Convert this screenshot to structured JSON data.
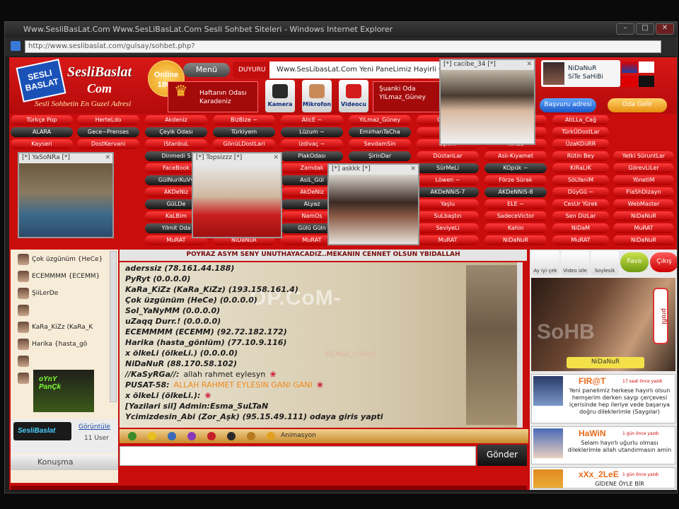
{
  "browser": {
    "title": "Www.SesliBasLat.Com Www.SesLiBasLat.Com Sesli Sohbet Siteleri - Windows Internet Explorer",
    "address": "http://www.seslibaslat.com/gulsay/sohbet.php?"
  },
  "header": {
    "logo_badge": "SESLI BASLAT",
    "logo_name": "SesliBaslat",
    "logo_com": "Com",
    "slogan": "Sesli Sohbetin En Guzel Adresi",
    "online_label": "Online",
    "online_count": "1803",
    "menu_label": "Menü",
    "ticker_tag": "DUYURU",
    "ticker_text": "Www.SesLibasLat.Com Yeni PaneLimiz Hayirli Olsun",
    "room_week_label": "Haftanın Odası",
    "room_week_name": "Karadeniz",
    "btn_camera": "Kamera",
    "btn_mic": "Mikrofon",
    "btn_video": "Videocu",
    "now_room_label": "Şuanki Oda",
    "now_room_name": "YILmaz_Güney",
    "owner_name": "NiDaNuR",
    "owner_title": "SiTe SaHiBi",
    "reg_label": "Başvuru adresi",
    "rooms_label": "Oda Gelir"
  },
  "room_grid": {
    "rows": [
      [
        "Türkçe Pop",
        "HerteLdo",
        "Akdeniz",
        "BizBize ~",
        "AlicE ~",
        "YiLmaz_Güney",
        "CEMALi",
        "Nefes Şiiri",
        "AtiLLa_Cağ"
      ],
      [
        "ALARA",
        "Gece~Prenses",
        "Çeyik Odası",
        "Türkiyem",
        "Lüzum ~",
        "EmirhanTaCha",
        "CanLi",
        "CanLiMuzik",
        "TürkÜDostLar"
      ],
      [
        "Kayseri",
        "DostKervani",
        "iStanbuL",
        "GönüLDostLari",
        "izdivaç ~",
        "SevdamSin",
        "aŞkım",
        "KiRaL",
        "ÜzaKDüRR"
      ],
      [
        "",
        "",
        "Dinmedi S",
        "",
        "PlakOdası",
        "ŞirinDar",
        "DüstanLar",
        "Aslı-Kıyamet",
        "Rütin Bey",
        "Yetki SüruntLar"
      ],
      [
        "",
        "",
        "FaceBook",
        "",
        "Zamdak",
        "",
        "SürMeLi",
        "KOpük ~",
        "KiRaLiK",
        "GörevLiLer"
      ],
      [
        "",
        "",
        "GülNuriKuVv",
        "",
        "AsiL_Gül",
        "",
        "Löwen ~",
        "Förze Sürak",
        "SöLYaniM",
        "YönetiM"
      ],
      [
        "",
        "",
        "AKDeNiz",
        "",
        "AkDeNiz",
        "",
        "AKDeNNiS-7",
        "AKDeNNiS-8",
        "DüyGü ~",
        "FlaShDizayn"
      ],
      [
        "",
        "",
        "GüLDe",
        "",
        "ALyaz",
        "",
        "Yaşlu",
        "ELE ~",
        "CesUr Yürek",
        "WebMaster"
      ],
      [
        "",
        "",
        "KaLBim",
        "",
        "NamOs",
        "",
        "SuLbaştın",
        "SadeceVictor",
        "Sen DizLar",
        "NiDaNuR"
      ],
      [
        "",
        "",
        "Yilmit Oda",
        "",
        "Gülü Güln",
        "",
        "SeviyeLi",
        "Kahin",
        "NiDaM",
        "MuRAT"
      ],
      [
        "",
        "",
        "MuRAT",
        "NiDaNuR",
        "MuRAT",
        "NiDaNuR",
        "MuRAT",
        "NiDaNuR",
        "MuRAT",
        "NiDaNuR"
      ]
    ]
  },
  "cams": [
    {
      "title": "[*] YaSoNRa [*]"
    },
    {
      "title": "[*] Topsizzz [*]"
    },
    {
      "title": "[*] askkk [*]"
    },
    {
      "title": "[*] cacibe_34 [*]"
    }
  ],
  "topic": "POYRAZ ASYM SENY UNUTHAYACADIZ..MEKANIN CENNET OLSUN YBIDALLAH",
  "users": [
    {
      "name": "Çok üzgünüm {HeCe}"
    },
    {
      "name": "ECEMMMM {ECEMM}"
    },
    {
      "name": "ŞiiLerDe"
    },
    {
      "name": ""
    },
    {
      "name": "KaRa_KiZz (KaRa_K"
    },
    {
      "name": "Harika {hasta_gö"
    },
    {
      "name": ""
    },
    {
      "name": ""
    }
  ],
  "users_footer": {
    "logo": "SesliBaslat",
    "link": "Görüntüle",
    "count": "11 User",
    "talk": "Konuşma"
  },
  "chat": {
    "watermark": "OP.CoM-",
    "signature": "YiLMaZ_GüNeY",
    "messages": [
      {
        "nick": "aderssiz (78.161.44.188)",
        "text": ""
      },
      {
        "nick": "PyRyt (0.0.0.0)",
        "text": ""
      },
      {
        "nick": "KaRa_KiZz (KaRa_KiZz) (193.158.161.4)",
        "text": ""
      },
      {
        "nick": "Çok üzgünüm (HeCe) (0.0.0.0)",
        "text": ""
      },
      {
        "nick": "Sol_YaNyMM (0.0.0.0)",
        "text": ""
      },
      {
        "nick": "uZaqq Durr.! (0.0.0.0)",
        "text": ""
      },
      {
        "nick": "ECEMMMM (ECEMM) (92.72.182.172)",
        "text": ""
      },
      {
        "nick": "Harika (hasta_gönlüm) (77.10.9.116)",
        "text": ""
      },
      {
        "nick": "x ölkeLi (ölkeLi.) (0.0.0.0)",
        "text": ""
      },
      {
        "nick": "NiDaNuR (88.170.58.102)",
        "text": ""
      },
      {
        "nick": "//KaSyRGa//:",
        "text": "allah rahmet eylesyn",
        "rose": "❀"
      },
      {
        "nick": "PUSAT-58:",
        "text": "ALLAH RAHMET EYLESIN GANI GANI",
        "rose": "❀",
        "orange": true
      },
      {
        "nick": "x ölkeLi (ölkeLi.):",
        "text": "",
        "rose": "❀"
      },
      {
        "nick": "[Yazilari sil] Admin:Esma_SuLTaN",
        "text": ""
      },
      {
        "nick": "Ycimizdesin_Abi (Zor_Aşk) (95.15.49.111) odaya giris yapti",
        "text": ""
      }
    ]
  },
  "toolbar": {
    "anim_label": "Animasyon"
  },
  "input": {
    "value": ""
  },
  "send_label": "Gönder",
  "right": {
    "icons": [
      "Ay iyi çek",
      "Video izle",
      "Soylesik"
    ],
    "fav_label": "Favo",
    "stop_label": "Çıkış",
    "profile_watermark": "SoHB",
    "profile_badge": "profil",
    "profile_name": "NiDaNuR",
    "notes": [
      {
        "name": "FIR@T",
        "time": "17 saat önce yazdı",
        "body": "Yeni panelimiz herkese hayırlı olsun hemşerim derken saygı çerçevesi içerisinde hep ileriye vede başarıya doğru dileklerimle (Saygılar)"
      },
      {
        "name": "HaWiN",
        "time": "1 gün önce yazdı",
        "body": "Selam hayırlı uğurlu olması dileklerimle allah utandırmasın amin"
      },
      {
        "name": "xXx_2LeE",
        "time": "1 gün önce yazdı",
        "body": "GİDENE ÖYLE BİR"
      }
    ]
  },
  "colors": {
    "site_red": "#c90d0d",
    "button_red": "#e01a1a",
    "button_dark": "#2a2a2a",
    "accent_orange": "#e99a10"
  }
}
